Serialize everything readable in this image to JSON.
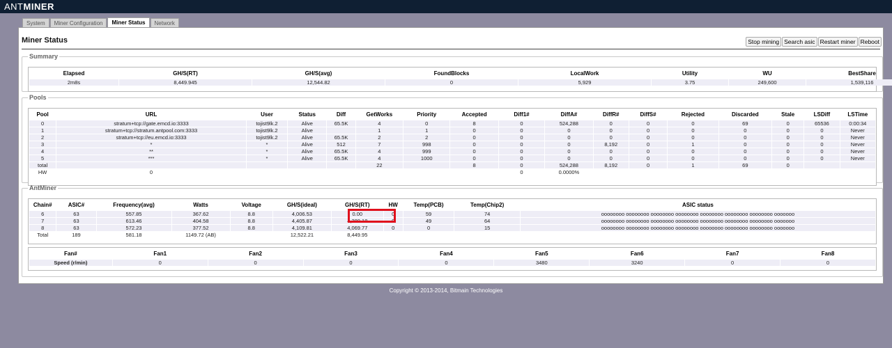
{
  "brand": {
    "prefix": "ANT",
    "suffix": "MINER"
  },
  "tabs": [
    "System",
    "Miner Configuration",
    "Miner Status",
    "Network"
  ],
  "page_title": "Miner Status",
  "actions": [
    "Stop mining",
    "Search asic",
    "Restart miner",
    "Reboot"
  ],
  "summary": {
    "legend": "Summary",
    "headers": [
      "Elapsed",
      "GH/S(RT)",
      "GH/S(avg)",
      "FoundBlocks",
      "LocalWork",
      "Utility",
      "WU",
      "BestShare"
    ],
    "values": [
      "2m8s",
      "8,449.945",
      "12,544.82",
      "0",
      "5,929",
      "3.75",
      "249,600",
      "1,539,116"
    ]
  },
  "pools": {
    "legend": "Pools",
    "headers": [
      "Pool",
      "URL",
      "User",
      "Status",
      "Diff",
      "GetWorks",
      "Priority",
      "Accepted",
      "Diff1#",
      "DiffA#",
      "DiffR#",
      "DiffS#",
      "Rejected",
      "Discarded",
      "Stale",
      "LSDiff",
      "LSTime"
    ],
    "rows": [
      [
        "0",
        "stratum+tcp://gate.emcd.io:3333",
        "tojist9lk.2",
        "Alive",
        "65.5K",
        "4",
        "0",
        "8",
        "0",
        "524,288",
        "0",
        "0",
        "0",
        "69",
        "0",
        "65536",
        "0:00:34"
      ],
      [
        "1",
        "stratum+tcp://stratum.antpool.com:3333",
        "tojist9lk.2",
        "Alive",
        "",
        "1",
        "1",
        "0",
        "0",
        "0",
        "0",
        "0",
        "0",
        "0",
        "0",
        "0",
        "Never"
      ],
      [
        "2",
        "stratum+tcp://eu.emcd.io:3333",
        "tojist9lk.2",
        "Alive",
        "65.5K",
        "2",
        "2",
        "0",
        "0",
        "0",
        "0",
        "0",
        "0",
        "0",
        "0",
        "0",
        "Never"
      ],
      [
        "3",
        "*",
        "*",
        "Alive",
        "512",
        "7",
        "998",
        "0",
        "0",
        "0",
        "8,192",
        "0",
        "1",
        "0",
        "0",
        "0",
        "Never"
      ],
      [
        "4",
        "**",
        "*",
        "Alive",
        "65.5K",
        "4",
        "999",
        "0",
        "0",
        "0",
        "0",
        "0",
        "0",
        "0",
        "0",
        "0",
        "Never"
      ],
      [
        "5",
        "***",
        "*",
        "Alive",
        "65.5K",
        "4",
        "1000",
        "0",
        "0",
        "0",
        "0",
        "0",
        "0",
        "0",
        "0",
        "0",
        "Never"
      ],
      [
        "total",
        "",
        "",
        "",
        "",
        "22",
        "",
        "8",
        "0",
        "524,288",
        "8,192",
        "0",
        "1",
        "69",
        "0",
        "",
        ""
      ],
      [
        "HW",
        "0",
        "",
        "",
        "",
        "",
        "",
        "",
        "0",
        "0.0000%",
        "",
        "",
        "",
        "",
        "",
        "",
        ""
      ]
    ]
  },
  "antminer": {
    "legend": "AntMiner",
    "headers": [
      "Chain#",
      "ASIC#",
      "Frequency(avg)",
      "Watts",
      "Voltage",
      "GH/S(ideal)",
      "GH/S(RT)",
      "HW",
      "Temp(PCB)",
      "Temp(Chip2)",
      "ASIC status"
    ],
    "rows": [
      [
        "6",
        "63",
        "557.85",
        "367.62",
        "8.8",
        "4,006.53",
        "0.00",
        "0",
        "59",
        "74",
        "oooooooo oooooooo oooooooo oooooooo oooooooo oooooooo oooooooo ooooooo"
      ],
      [
        "7",
        "63",
        "613.46",
        "404.58",
        "8.8",
        "4,405.87",
        "4,380.18",
        "0",
        "49",
        "64",
        "oooooooo oooooooo oooooooo oooooooo oooooooo oooooooo oooooooo ooooooo"
      ],
      [
        "8",
        "63",
        "572.23",
        "377.52",
        "8.8",
        "4,109.81",
        "4,069.77",
        "0",
        "0",
        "15",
        "oooooooo oooooooo oooooooo oooooooo oooooooo oooooooo oooooooo ooooooo"
      ],
      [
        "Total",
        "189",
        "581.18",
        "1149.72 (AB)",
        "",
        "12,522.21",
        "8,449.95",
        "",
        "",
        "",
        ""
      ]
    ],
    "fan_headers": [
      "Fan#",
      "Fan1",
      "Fan2",
      "Fan3",
      "Fan4",
      "Fan5",
      "Fan6",
      "Fan7",
      "Fan8"
    ],
    "fan_row": [
      "Speed (r/min)",
      "0",
      "0",
      "0",
      "0",
      "3480",
      "3240",
      "0",
      "0"
    ]
  },
  "footer": "Copyright © 2013-2014, Bitmain Technologies",
  "colors": {
    "topbar": "#0f1f33",
    "background": "#8d8aa0",
    "row_tint": "#eeedf6",
    "highlight": "#e0101c"
  }
}
